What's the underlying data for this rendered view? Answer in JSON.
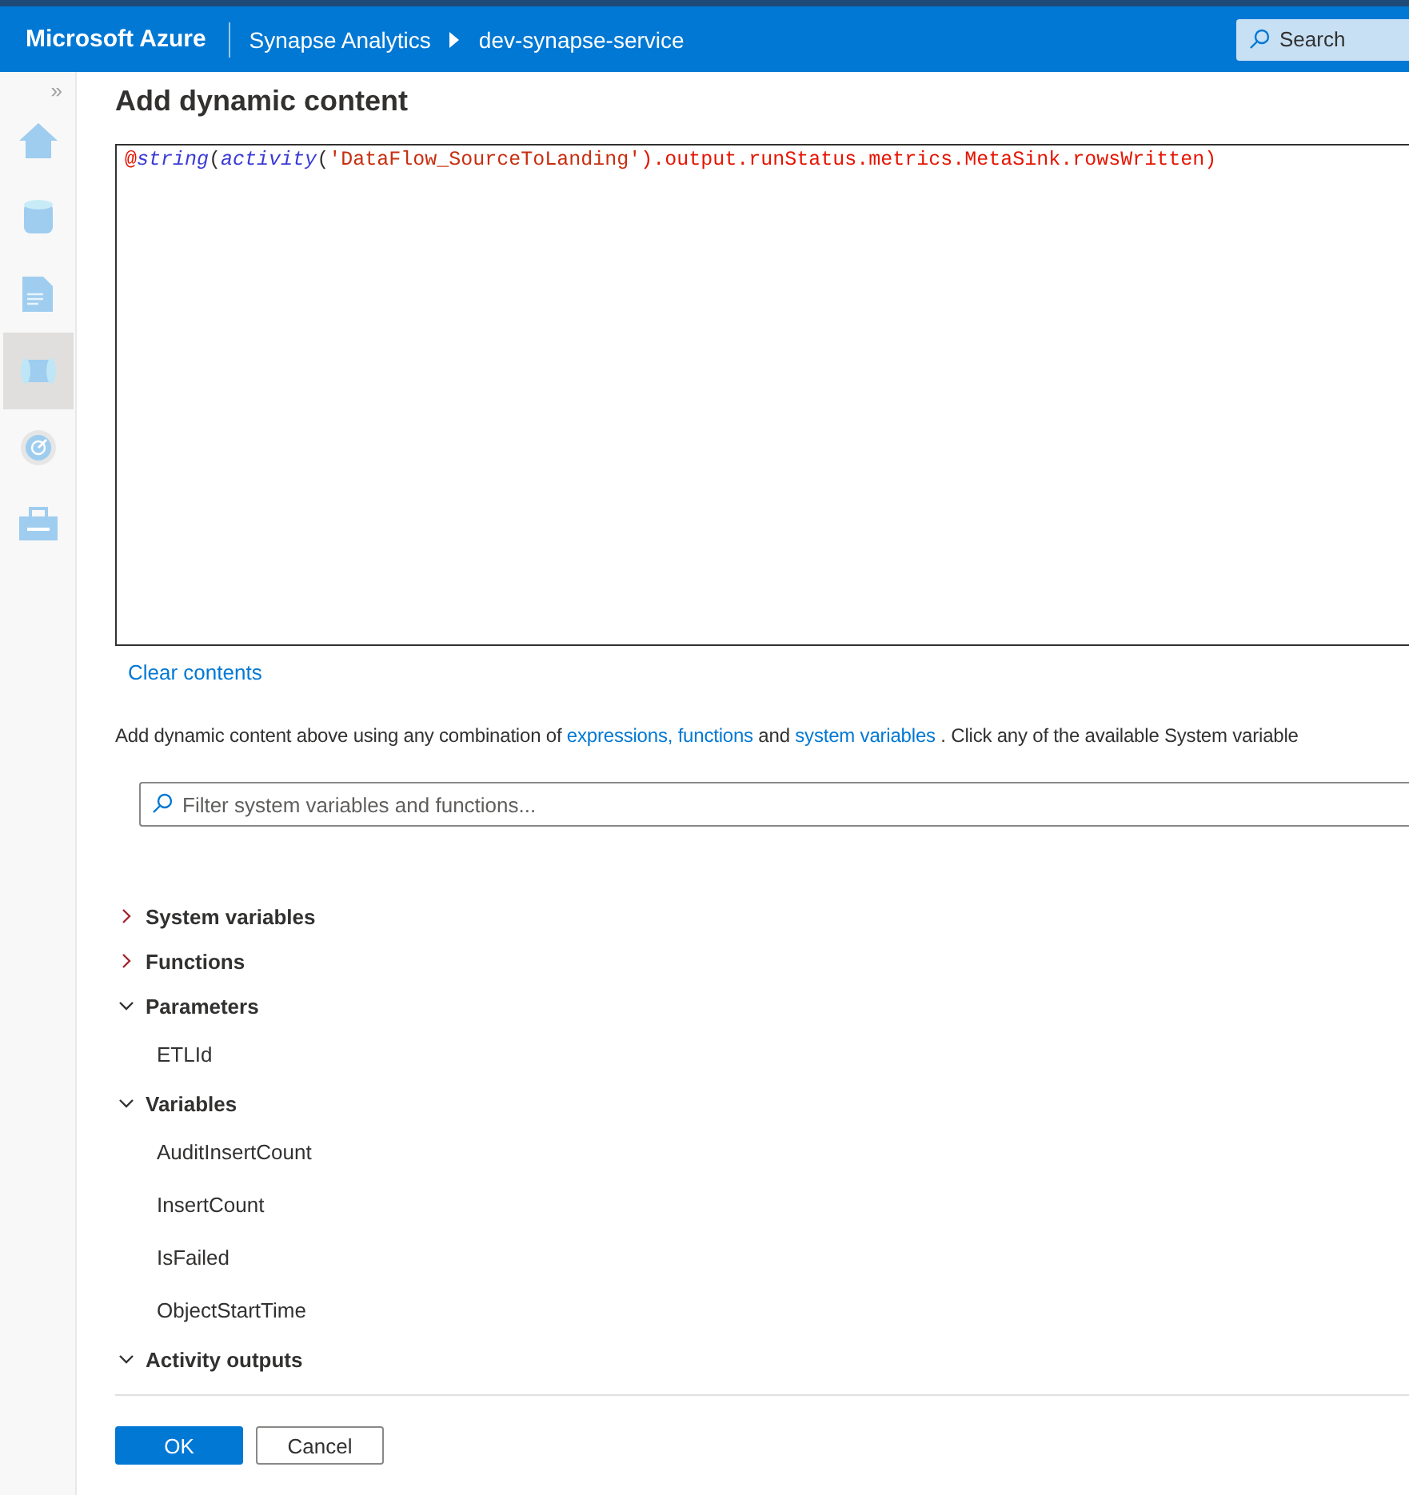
{
  "header": {
    "brand": "Microsoft Azure",
    "breadcrumbs": [
      "Synapse Analytics",
      "dev-synapse-service"
    ],
    "search": {
      "placeholder": "Search"
    }
  },
  "sidebar": {
    "collapse_glyph": "»",
    "items": [
      {
        "kind": "home",
        "selected": false
      },
      {
        "kind": "data",
        "selected": false
      },
      {
        "kind": "develop",
        "selected": false
      },
      {
        "kind": "integrate",
        "selected": true
      },
      {
        "kind": "monitor",
        "selected": false
      },
      {
        "kind": "manage",
        "selected": false
      }
    ]
  },
  "dialog": {
    "title": "Add dynamic content",
    "expression": [
      {
        "text": "@",
        "kind": "symbol"
      },
      {
        "text": "string",
        "kind": "function"
      },
      {
        "text": "(",
        "kind": "punct"
      },
      {
        "text": "activity",
        "kind": "function"
      },
      {
        "text": "(",
        "kind": "punct"
      },
      {
        "text": "'DataFlow_SourceToLanding'",
        "kind": "string"
      },
      {
        "text": ").output.runStatus.metrics.MetaSink.rowsWritten)",
        "kind": "symbol"
      }
    ],
    "clear_link": "Clear contents",
    "help": [
      {
        "text": "Add dynamic content above using any combination of ",
        "kind": "plain"
      },
      {
        "text": "expressions, functions",
        "kind": "link"
      },
      {
        "text": " and ",
        "kind": "plain"
      },
      {
        "text": "system variables",
        "kind": "link"
      },
      {
        "text": " . Click any of the available System variable",
        "kind": "plain"
      }
    ],
    "filter": {
      "placeholder": "Filter system variables and functions..."
    },
    "sections": [
      {
        "label": "System variables",
        "expanded": false
      },
      {
        "label": "Functions",
        "expanded": false
      },
      {
        "label": "Parameters",
        "expanded": true,
        "children": [
          "ETLId"
        ]
      },
      {
        "label": "Variables",
        "expanded": true,
        "children": [
          "AuditInsertCount",
          "InsertCount",
          "IsFailed",
          "ObjectStartTime"
        ]
      },
      {
        "label": "Activity outputs",
        "expanded": true
      }
    ],
    "buttons": [
      {
        "label": "OK",
        "kind": "primary"
      },
      {
        "label": "Cancel",
        "kind": "secondary"
      }
    ]
  }
}
